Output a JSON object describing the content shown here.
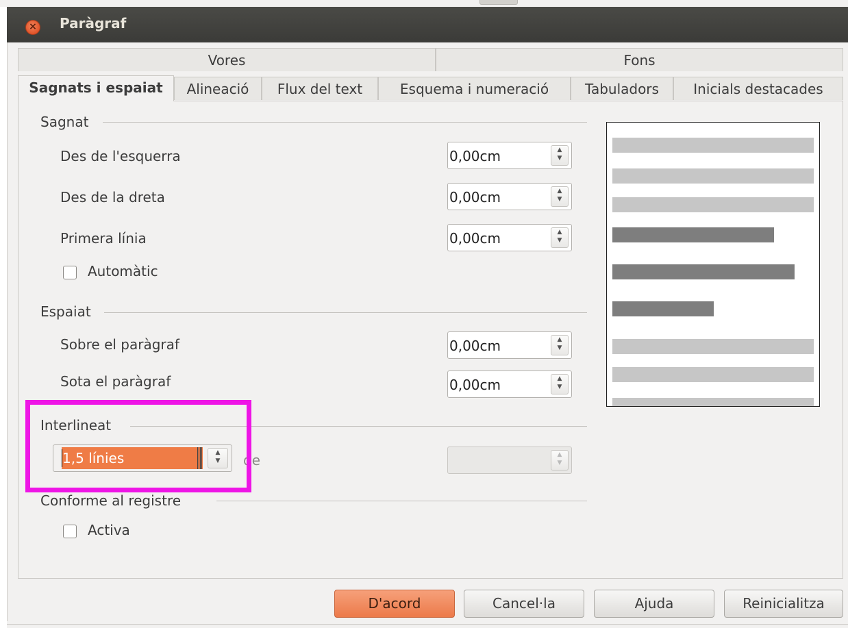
{
  "window": {
    "title": "Paràgraf"
  },
  "tabs_row1": [
    {
      "label": "Vores"
    },
    {
      "label": "Fons"
    }
  ],
  "tabs_row2": [
    {
      "label": "Sagnats i espaiat",
      "active": true
    },
    {
      "label": "Alineació"
    },
    {
      "label": "Flux del text"
    },
    {
      "label": "Esquema i numeració"
    },
    {
      "label": "Tabuladors"
    },
    {
      "label": "Inicials destacades"
    }
  ],
  "indent": {
    "section": "Sagnat",
    "from_left": {
      "label": "Des de l'esquerra",
      "value": "0,00cm"
    },
    "from_right": {
      "label": "Des de la dreta",
      "value": "0,00cm"
    },
    "first_line": {
      "label": "Primera línia",
      "value": "0,00cm"
    },
    "automatic": {
      "label": "Automàtic",
      "checked": false
    }
  },
  "spacing": {
    "section": "Espaiat",
    "above": {
      "label": "Sobre el paràgraf",
      "value": "0,00cm"
    },
    "below": {
      "label": "Sota el paràgraf",
      "value": "0,00cm"
    }
  },
  "line_spacing": {
    "section": "Interlineat",
    "selected": "1,5 línies",
    "of_label": "de",
    "of_value": "",
    "highlight_color": "#ee15e6"
  },
  "register": {
    "section": "Conforme al registre",
    "activate": {
      "label": "Activa",
      "checked": false
    }
  },
  "buttons": {
    "ok": "D'acord",
    "cancel": "Cancel·la",
    "help": "Ajuda",
    "reset": "Reinicialitza"
  },
  "colors": {
    "accent": "#ef7c46",
    "titlebar": "#3f3f3c",
    "dialog_bg": "#f2f1f0"
  },
  "icons": {
    "close": "close-icon",
    "spin": "spin-arrows-icon"
  }
}
